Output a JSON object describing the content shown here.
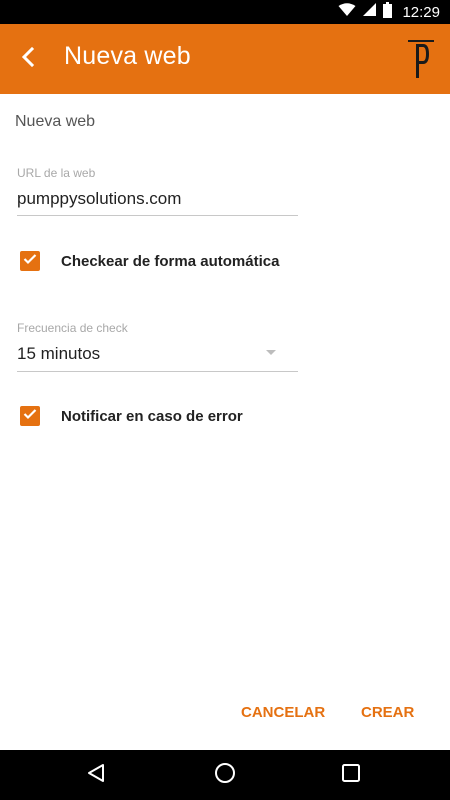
{
  "status_bar": {
    "time": "12:29",
    "icons": [
      "wifi-icon",
      "signal-icon",
      "battery-icon"
    ]
  },
  "app_bar": {
    "title": "Nueva web",
    "back_icon": "chevron-left-icon",
    "logo_letter": "P",
    "color": "#E57111"
  },
  "form": {
    "section_title": "Nueva web",
    "url_label": "URL de la web",
    "url_value": "pumppysolutions.com",
    "auto_check_label": "Checkear de forma automática",
    "auto_check_checked": true,
    "frequency_label": "Frecuencia de check",
    "frequency_value": "15 minutos",
    "notify_label": "Notificar en caso de error",
    "notify_checked": true
  },
  "actions": {
    "cancel_label": "CANCELAR",
    "create_label": "CREAR",
    "accent": "#E57111"
  },
  "nav_bar": {
    "icons": [
      "back-triangle-icon",
      "home-circle-icon",
      "recents-square-icon"
    ]
  }
}
